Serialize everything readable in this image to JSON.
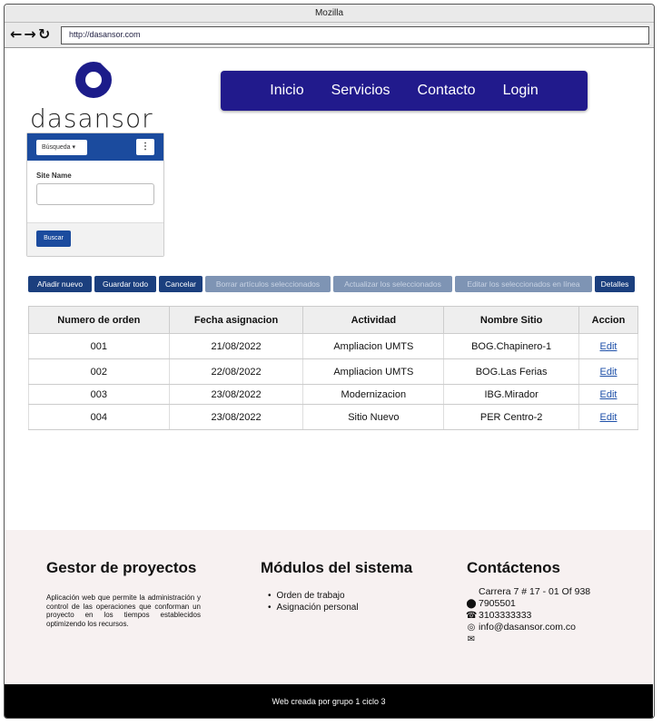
{
  "browser": {
    "title": "Mozilla",
    "url": "http://dasansor.com",
    "icons": [
      "back-arrow-icon",
      "forward-arrow-icon",
      "reload-icon"
    ]
  },
  "logo": {
    "text": "dasansor"
  },
  "nav": {
    "items": [
      "Inicio",
      "Servicios",
      "Contacto",
      "Login"
    ]
  },
  "search": {
    "dropdown_label": "Búsqueda ▾",
    "kebab": "⋮",
    "field_label": "Site Name",
    "field_value": "",
    "button": "Buscar"
  },
  "toolbar": {
    "buttons": [
      {
        "label": "Añadir nuevo",
        "enabled": true
      },
      {
        "label": "Guardar todo",
        "enabled": true
      },
      {
        "label": "Cancelar",
        "enabled": true
      },
      {
        "label": "Borrar artículos seleccionados",
        "enabled": false
      },
      {
        "label": "Actualizar los seleccionados",
        "enabled": false
      },
      {
        "label": "Editar los seleccionados en línea",
        "enabled": false
      },
      {
        "label": "Detalles",
        "enabled": true
      }
    ]
  },
  "table": {
    "headers": [
      "Numero de orden",
      "Fecha asignacion",
      "Actividad",
      "Nombre Sitio",
      "Accion"
    ],
    "rows": [
      [
        "001",
        "21/08/2022",
        "Ampliacion UMTS",
        "BOG.Chapinero-1",
        "Edit"
      ],
      [
        "002",
        "22/08/2022",
        "Ampliacion UMTS",
        "BOG.Las Ferias",
        "Edit"
      ],
      [
        "003",
        "23/08/2022",
        "Modernizacion",
        "IBG.Mirador",
        "Edit"
      ],
      [
        "004",
        "23/08/2022",
        "Sitio Nuevo",
        "PER Centro-2",
        "Edit"
      ]
    ]
  },
  "footer": {
    "col1": {
      "title": "Gestor de proyectos",
      "text": "Aplicación web que permite la administración y control de las operaciones que conforman un proyecto en los tiempos establecidos optimizendo los recursos."
    },
    "col2": {
      "title": "Módulos del sistema",
      "items": [
        "Orden de trabajo",
        "Asignación personal"
      ]
    },
    "col3": {
      "title": "Contáctenos",
      "address": "Carrera 7 # 17 - 01 Of 938",
      "phone1": "7905501",
      "phone2": "3103333333",
      "email": "info@dasansor.com.co",
      "icons": [
        "location-pin-icon",
        "phone-icon",
        "whatsapp-icon",
        "mail-icon"
      ]
    }
  },
  "bottom": {
    "text": "Web creada por grupo 1 ciclo 3"
  }
}
